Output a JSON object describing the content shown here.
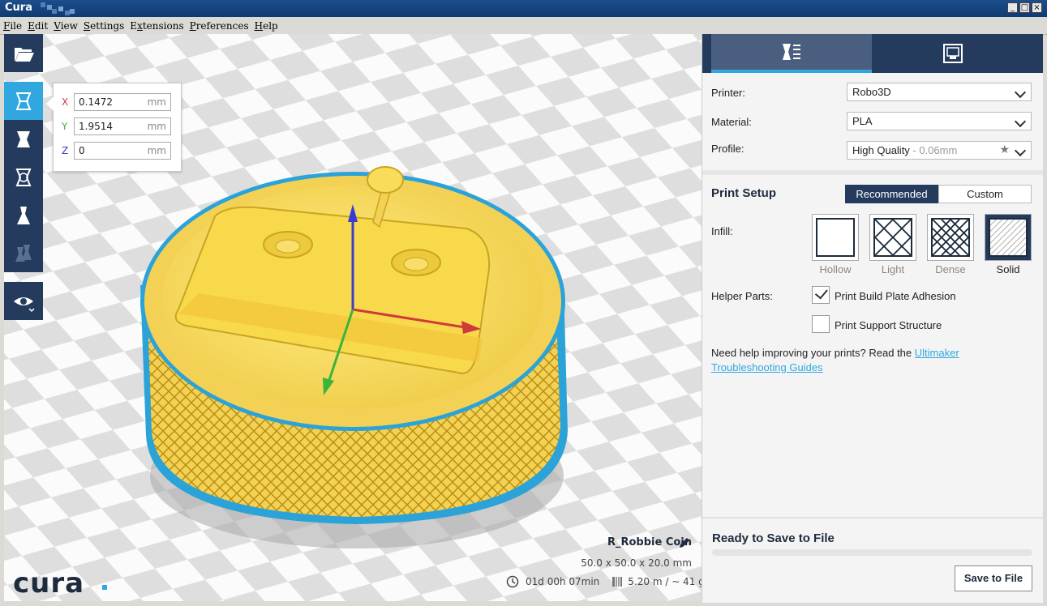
{
  "window": {
    "title": "Cura"
  },
  "menu": [
    "File",
    "Edit",
    "View",
    "Settings",
    "Extensions",
    "Preferences",
    "Help"
  ],
  "menu_mnemonic": [
    "F",
    "E",
    "V",
    "S",
    "x",
    "P",
    "H"
  ],
  "toolbar": {
    "items": [
      "open-file-icon",
      "move-tool-icon",
      "scale-tool-icon",
      "rotate-tool-icon",
      "mirror-tool-icon",
      "per-object-settings-icon",
      "view-mode-icon"
    ]
  },
  "move_panel": {
    "x_label": "X",
    "x_value": "0.1472",
    "y_label": "Y",
    "y_value": "1.9514",
    "z_label": "Z",
    "z_value": "0",
    "unit": "mm"
  },
  "logo": {
    "text": "cura"
  },
  "model": {
    "name": "R_Robbie Coin",
    "dimensions": "50.0 x 50.0 x 20.0 mm",
    "print_time": "01d 00h 07min",
    "material_usage": "5.20 m / ~ 41 g"
  },
  "sidebar": {
    "printer_label": "Printer:",
    "printer_value": "Robo3D",
    "material_label": "Material:",
    "material_value": "PLA",
    "profile_label": "Profile:",
    "profile_value": "High Quality",
    "profile_suffix": " - 0.06mm",
    "print_setup_title": "Print Setup",
    "mode_recommended": "Recommended",
    "mode_custom": "Custom",
    "infill_label": "Infill:",
    "infill_options": [
      "Hollow",
      "Light",
      "Dense",
      "Solid"
    ],
    "infill_selected": "Solid",
    "helper_label": "Helper Parts:",
    "adhesion_label": "Print Build Plate Adhesion",
    "adhesion_checked": true,
    "support_label": "Print Support Structure",
    "support_checked": false,
    "help_text": "Need help improving your prints? Read the ",
    "help_link": "Ultimaker Troubleshooting Guides"
  },
  "save": {
    "status": "Ready to Save to File",
    "progress": 0,
    "button": "Save to File"
  },
  "colors": {
    "navy": "#243b5e",
    "accent": "#30a7df",
    "model": "#f5d75a"
  }
}
